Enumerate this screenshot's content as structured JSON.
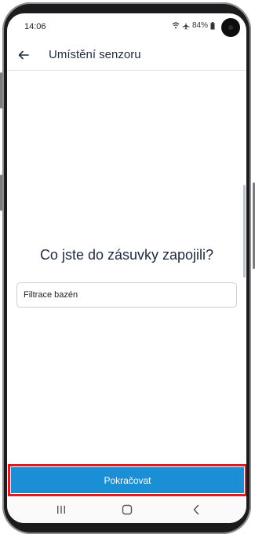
{
  "status_bar": {
    "time": "14:06",
    "battery": "84%",
    "icons": [
      "wifi-icon",
      "airplane-icon",
      "battery-icon"
    ]
  },
  "app_bar": {
    "title": "Umístění senzoru",
    "back_icon": "arrow-left-icon"
  },
  "main": {
    "question": "Co jste do zásuvky zapojili?",
    "input_value": "Filtrace bazén",
    "continue_label": "Pokračovat"
  },
  "nav_bar": {
    "items": [
      "recents-icon",
      "home-icon",
      "back-icon"
    ]
  },
  "colors": {
    "primary": "#1a8fd6",
    "highlight": "#e31b1b",
    "title_text": "#1f2a44"
  }
}
